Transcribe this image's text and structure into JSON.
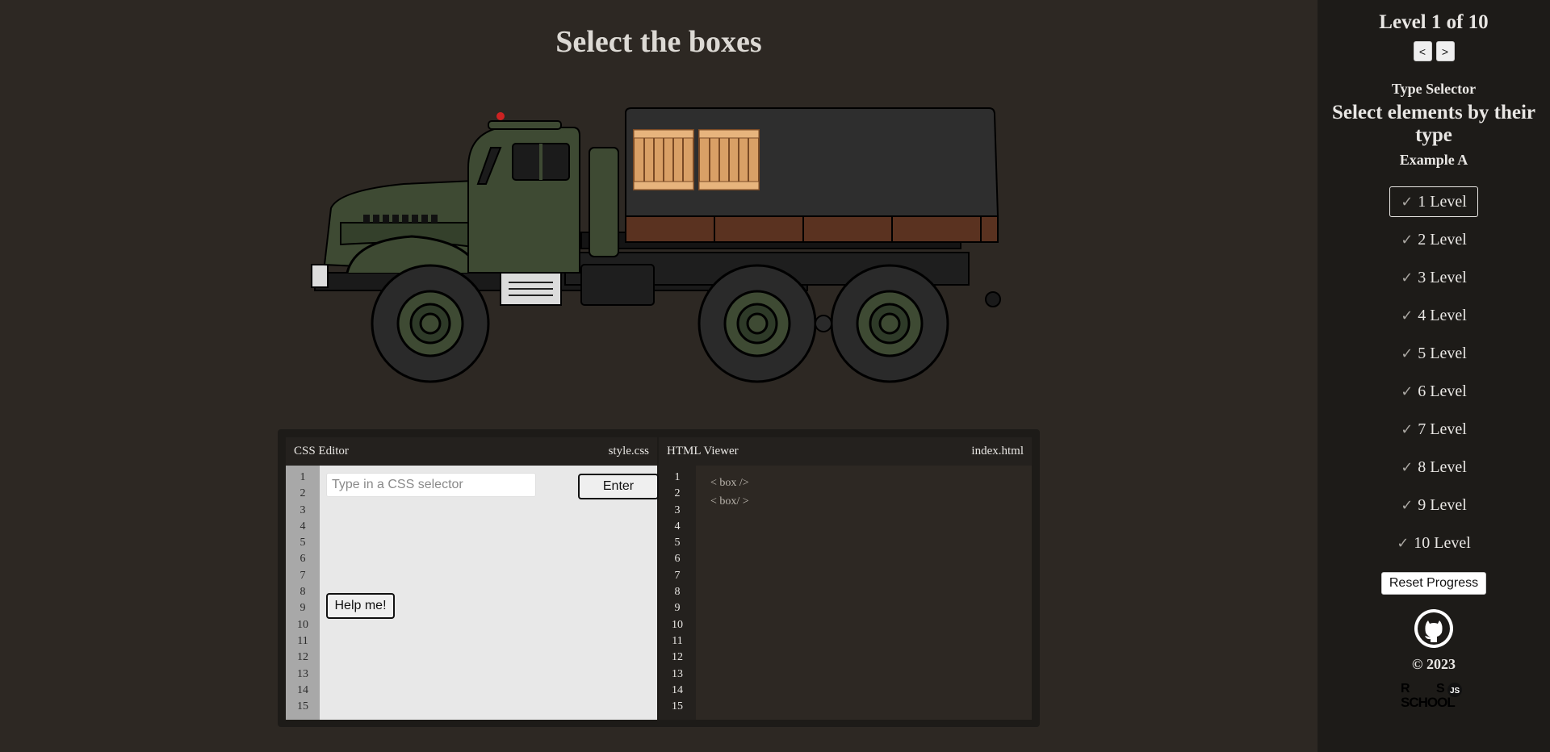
{
  "main": {
    "title": "Select the boxes"
  },
  "css_editor": {
    "header": "CSS Editor",
    "filename": "style.css",
    "placeholder": "Type in a CSS selector",
    "enter_label": "Enter",
    "help_label": "Help me!",
    "line_numbers": [
      "1",
      "2",
      "3",
      "4",
      "5",
      "6",
      "7",
      "8",
      "9",
      "10",
      "11",
      "12",
      "13",
      "14",
      "15"
    ]
  },
  "html_viewer": {
    "header": "HTML Viewer",
    "filename": "index.html",
    "code_lines": [
      "< box />",
      "< box/ >"
    ],
    "line_numbers": [
      "1",
      "2",
      "3",
      "4",
      "5",
      "6",
      "7",
      "8",
      "9",
      "10",
      "11",
      "12",
      "13",
      "14",
      "15"
    ]
  },
  "sidebar": {
    "level_title": "Level 1 of 10",
    "prev_label": "<",
    "next_label": ">",
    "selector_type": "Type Selector",
    "selector_desc": "Select elements by their type",
    "example": "Example A",
    "check_glyph": "✓",
    "levels": [
      "1 Level",
      "2 Level",
      "3 Level",
      "4 Level",
      "5 Level",
      "6 Level",
      "7 Level",
      "8 Level",
      "9 Level",
      "10 Level"
    ],
    "active_level": 0,
    "reset_label": "Reset Progress",
    "copyright": "© 2023",
    "school_logo_text": "RS SCHOOL"
  },
  "icons": [
    "github-icon",
    "rs-school-logo",
    "check-icon",
    "truck-illustration",
    "box-icon"
  ],
  "colors": {
    "background": "#2d2823",
    "sidebar": "#1d1b18",
    "truck_green": "#3e4a33",
    "tarp": "#2e2e2e",
    "crate": "#d9a066"
  }
}
